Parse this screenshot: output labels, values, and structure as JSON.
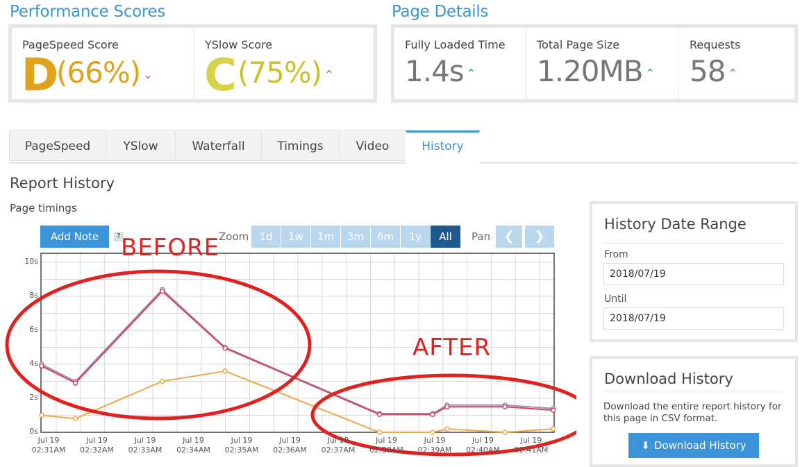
{
  "performance": {
    "title": "Performance Scores",
    "pagespeed": {
      "label": "PageSpeed Score",
      "grade": "D",
      "percent": "(66%)",
      "trend": "down",
      "color": "#e0a21a"
    },
    "yslow": {
      "label": "YSlow Score",
      "grade": "C",
      "percent": "(75%)",
      "trend": "up",
      "color": "#c9c229"
    }
  },
  "details": {
    "title": "Page Details",
    "loaded": {
      "label": "Fully Loaded Time",
      "value": "1.4s"
    },
    "size": {
      "label": "Total Page Size",
      "value": "1.20MB"
    },
    "requests": {
      "label": "Requests",
      "value": "58"
    }
  },
  "tabs": [
    "PageSpeed",
    "YSlow",
    "Waterfall",
    "Timings",
    "Video",
    "History"
  ],
  "active_tab": "History",
  "report": {
    "title": "Report History",
    "subtitle": "Page timings",
    "add_note": "Add Note",
    "help": "?",
    "zoom_label": "Zoom",
    "zoom_options": [
      "1d",
      "1w",
      "1m",
      "3m",
      "6m",
      "1y",
      "All"
    ],
    "zoom_selected": "All",
    "pan_label": "Pan",
    "pan_prev": "❮",
    "pan_next": "❯"
  },
  "annotations": {
    "before": "BEFORE",
    "after": "AFTER"
  },
  "date_range": {
    "title": "History Date Range",
    "from_label": "From",
    "from_value": "2018/07/19",
    "until_label": "Until",
    "until_value": "2018/07/19"
  },
  "download": {
    "title": "Download History",
    "description": "Download the entire report history for this page in CSV format.",
    "button": "Download History"
  },
  "chart_data": {
    "type": "line",
    "ylim": [
      0,
      10
    ],
    "yticks": [
      "0s",
      "2s",
      "4s",
      "6s",
      "8s",
      "10s"
    ],
    "xticks": [
      [
        "Jul 19",
        "02:31AM"
      ],
      [
        "Jul 19",
        "02:32AM"
      ],
      [
        "Jul 19",
        "02:33AM"
      ],
      [
        "Jul 19",
        "02:34AM"
      ],
      [
        "Jul 19",
        "02:35AM"
      ],
      [
        "Jul 19",
        "02:36AM"
      ],
      [
        "Jul 19",
        "02:37AM"
      ],
      [
        "Jul 19",
        "02:38AM"
      ],
      [
        "Jul 19",
        "02:39AM"
      ],
      [
        "Jul 19",
        "02:40AM"
      ],
      [
        "Jul 19",
        "02:41AM"
      ]
    ],
    "x": [
      0.0,
      0.7,
      2.5,
      3.8,
      7.0,
      8.1,
      8.4,
      9.6,
      10.6
    ],
    "series": [
      {
        "color": "#9b8fc0",
        "values": [
          4.0,
          3.0,
          8.4,
          5.0,
          1.1,
          1.1,
          1.6,
          1.6,
          1.4
        ]
      },
      {
        "color": "#d64550",
        "values": [
          3.9,
          2.9,
          8.3,
          4.95,
          1.05,
          1.05,
          1.5,
          1.5,
          1.3
        ]
      },
      {
        "color": "#f0a64a",
        "values": [
          1.0,
          0.8,
          3.0,
          3.6,
          0.0,
          0.0,
          0.2,
          0.0,
          0.2
        ]
      }
    ],
    "grid": true
  }
}
